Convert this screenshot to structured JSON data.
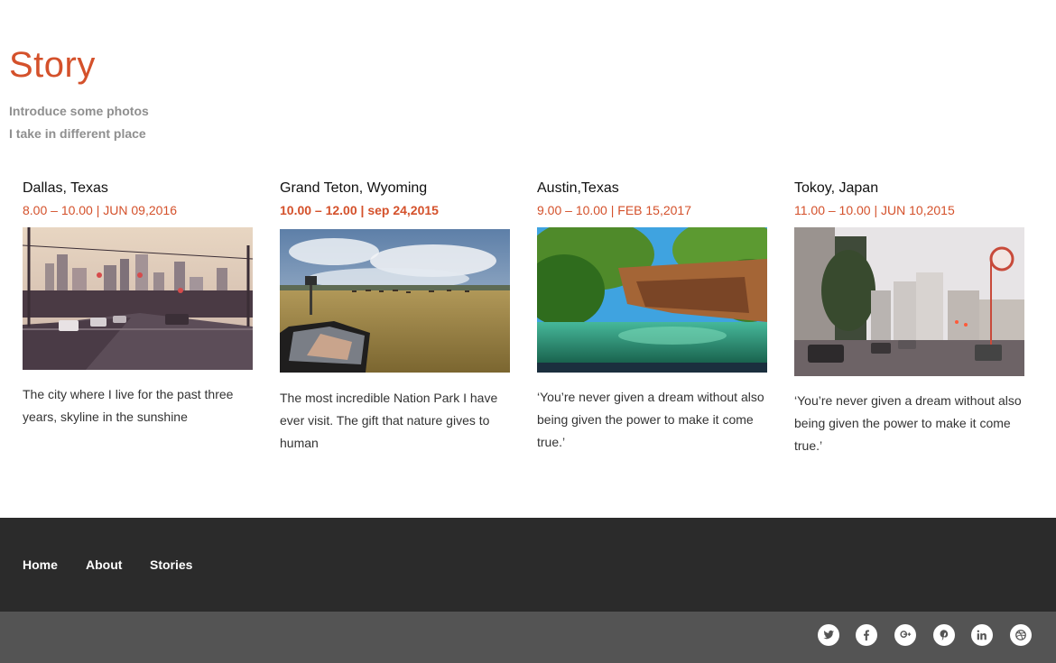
{
  "header": {
    "title": "Story",
    "intro_line1": "Introduce some photos",
    "intro_line2": "I take in different place"
  },
  "stories": [
    {
      "location": "Dallas, Texas",
      "meta": "8.00 – 10.00 | JUN 09,2016",
      "text": "The city where I live for the past three years, skyline in the sunshine"
    },
    {
      "location": "Grand Teton, Wyoming",
      "meta": "10.00 – 12.00 | sep 24,2015",
      "text": "The most incredible Nation Park I have ever visit. The gift that nature gives to human"
    },
    {
      "location": "Austin,Texas",
      "meta": "9.00 – 10.00 | FEB 15,2017",
      "text": "‘You’re never given a dream without also being given the power to make it come true.’"
    },
    {
      "location": "Tokoy, Japan",
      "meta": "11.00 – 10.00 | JUN 10,2015",
      "text": "‘You’re never given a dream without also being given the power to make it come true.’"
    }
  ],
  "footer": {
    "nav": [
      "Home",
      "About",
      "Stories"
    ],
    "social_icons": [
      "twitter-icon",
      "facebook-icon",
      "google-plus-icon",
      "pinterest-icon",
      "linkedin-icon",
      "dribbble-icon"
    ]
  },
  "colors": {
    "accent": "#d4512b",
    "footer_top": "#2b2b2b",
    "footer_bottom": "#545454"
  }
}
